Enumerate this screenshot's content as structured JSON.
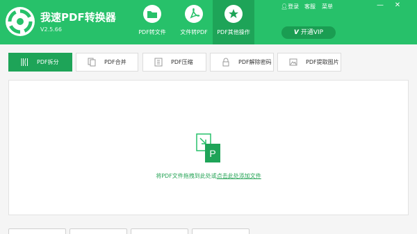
{
  "app": {
    "title": "我速PDF转换器",
    "version": "V2.5.66"
  },
  "nav_tabs": [
    {
      "label": "PDF转文件",
      "icon": "folder-icon",
      "active": false
    },
    {
      "label": "文件转PDF",
      "icon": "pdf-icon",
      "active": false
    },
    {
      "label": "PDF其他操作",
      "icon": "star-icon",
      "active": true
    }
  ],
  "top_links": {
    "login": "登录",
    "service": "客服",
    "menu": "菜单"
  },
  "window_controls": {
    "minimize": "—",
    "close": "✕"
  },
  "vip": {
    "mark": "V",
    "label": "开通VIP"
  },
  "sub_tabs": [
    {
      "label": "PDF拆分",
      "icon": "split-icon",
      "active": true
    },
    {
      "label": "PDF合并",
      "icon": "merge-icon",
      "active": false
    },
    {
      "label": "PDF压缩",
      "icon": "compress-icon",
      "active": false
    },
    {
      "label": "PDF解除密码",
      "icon": "unlock-icon",
      "active": false
    },
    {
      "label": "PDF提取图片",
      "icon": "image-icon",
      "active": false
    }
  ],
  "dropzone": {
    "hint_prefix": "将PDF文件拖拽到此处或",
    "hint_link": "点击此处添加文件",
    "file_letter": "P"
  },
  "colors": {
    "brand": "#27c16a",
    "active_tab": "#1ea458",
    "vip_button": "#1a9d52",
    "hint_text": "#27a457"
  }
}
